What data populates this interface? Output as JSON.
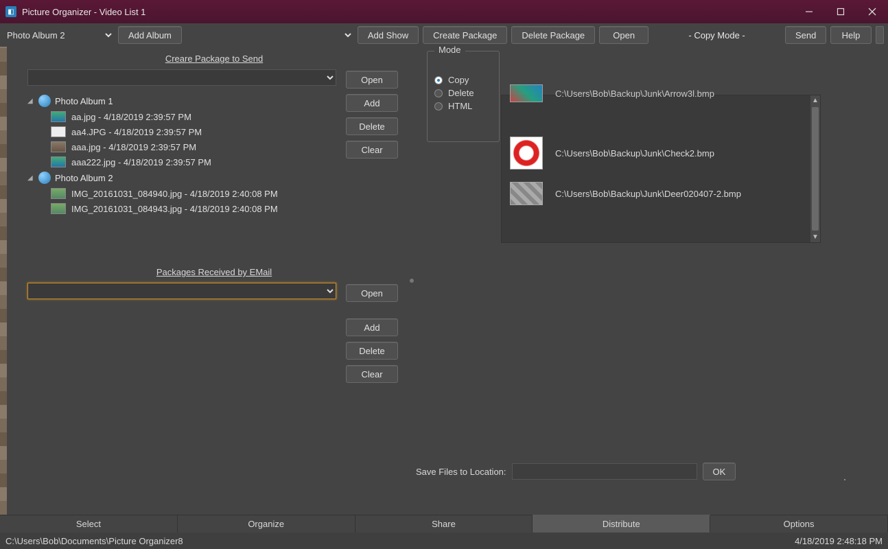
{
  "window": {
    "title": "Picture Organizer - Video List 1"
  },
  "toolbar": {
    "album_selected": "Photo Album 2",
    "add_album": "Add Album",
    "add_show": "Add Show",
    "create_package": "Create Package",
    "delete_package": "Delete Package",
    "open": "Open",
    "mode_label": "- Copy Mode -",
    "send": "Send",
    "help": "Help"
  },
  "left": {
    "create_heading": "Creare Package to Send",
    "received_heading": "Packages Received by EMail",
    "btns": {
      "open": "Open",
      "add": "Add",
      "delete": "Delete",
      "clear": "Clear"
    },
    "albums": [
      {
        "name": "Photo Album 1",
        "items": [
          "aa.jpg - 4/18/2019 2:39:57 PM",
          "aa4.JPG - 4/18/2019 2:39:57 PM",
          "aaa.jpg - 4/18/2019 2:39:57 PM",
          "aaa222.jpg - 4/18/2019 2:39:57 PM"
        ]
      },
      {
        "name": "Photo Album 2",
        "items": [
          "IMG_20161031_084940.jpg - 4/18/2019 2:40:08 PM",
          "IMG_20161031_084943.jpg - 4/18/2019 2:40:08 PM"
        ]
      }
    ]
  },
  "mode": {
    "legend": "Mode",
    "options": [
      "Copy",
      "Delete",
      "HTML"
    ],
    "selected": "Copy"
  },
  "preview": {
    "items": [
      "C:\\Users\\Bob\\Backup\\Junk\\Arrow3l.bmp",
      "C:\\Users\\Bob\\Backup\\Junk\\Check2.bmp",
      "C:\\Users\\Bob\\Backup\\Junk\\Deer020407-2.bmp"
    ]
  },
  "save": {
    "label": "Save Files to Location:",
    "value": "",
    "ok": "OK"
  },
  "tabs": {
    "items": [
      "Select",
      "Organize",
      "Share",
      "Distribute",
      "Options"
    ],
    "active": "Distribute"
  },
  "status": {
    "path": "C:\\Users\\Bob\\Documents\\Picture Organizer8",
    "time": "4/18/2019 2:48:18 PM"
  }
}
